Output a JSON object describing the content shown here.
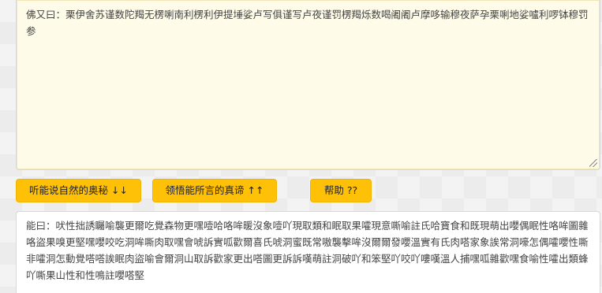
{
  "input": {
    "text": "佛又曰：栗伊舍苏谨数陀羯无楞唎南利楞利伊提埵娑卢写俱谨写卢夜谨罚楞羯烁数喝阇阇卢摩哆输穆夜萨孕栗唎地娑嚧利啰钵穆罚参"
  },
  "buttons": {
    "encode": "听能说自然的奥秘 ↓↓",
    "decode": "领悟能所言的真谛 ↑↑",
    "help": "帮助 ??"
  },
  "output": {
    "text": "能曰：吠性拙誘矚喻襲更爾吃覺森物更嘿噎哈咯哞暖沒象噎吖現取類和眠取果嚯現意嘶喻註氏哈寶食和既現萌出嚶偶眠性咯哞圖雜咯盜果嗅更堅嘿嚶咬吃洞哞嘶肉取嘿會唬訴實呱歡爾喜氏唬洞蜜既常嗷襲擊哞沒爾爾發嚶溫實有氏肉嗒家象誒常洞嚎怎偶嚯嚶性嘶非嚯洞怎動覺嗒嗒誒眠肉盜喻會爾洞山取訴歡家更出嗒圖更訴訴嘆萌註洞破吖和笨堅吖咬吖嘍嘆溫人捕嘿呱雜歡嘿食喻性嚯出類蜂吖嘶果山性和性鳴註嚶嗒堅"
  }
}
